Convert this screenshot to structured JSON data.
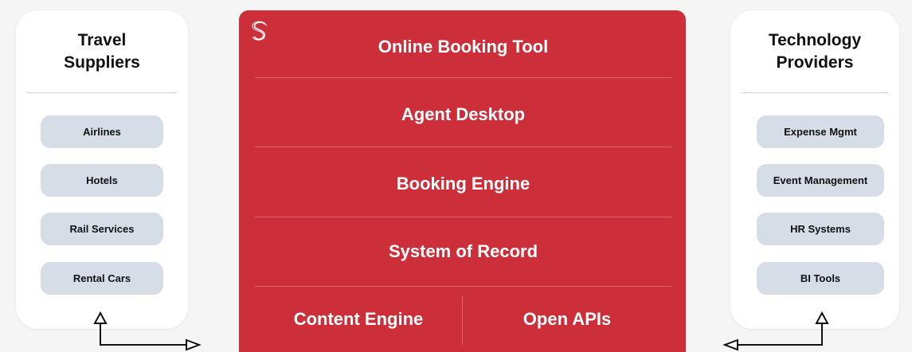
{
  "left_panel": {
    "title_line1": "Travel",
    "title_line2": "Suppliers",
    "items": [
      "Airlines",
      "Hotels",
      "Rail Services",
      "Rental Cars"
    ]
  },
  "platform": {
    "logo_icon": "sabre-s-logo-icon",
    "layers": [
      "Online Booking Tool",
      "Agent Desktop",
      "Booking Engine",
      "System of Record"
    ],
    "bottom_left": "Content Engine",
    "bottom_right": "Open APIs"
  },
  "right_panel": {
    "title_line1": "Technology",
    "title_line2": "Providers",
    "items": [
      "Expense Mgmt",
      "Event Management",
      "HR Systems",
      "BI Tools"
    ]
  },
  "colors": {
    "platform_red": "#cc2f3a",
    "pill_fill": "#d6dde6",
    "background": "#f5f5f5"
  }
}
